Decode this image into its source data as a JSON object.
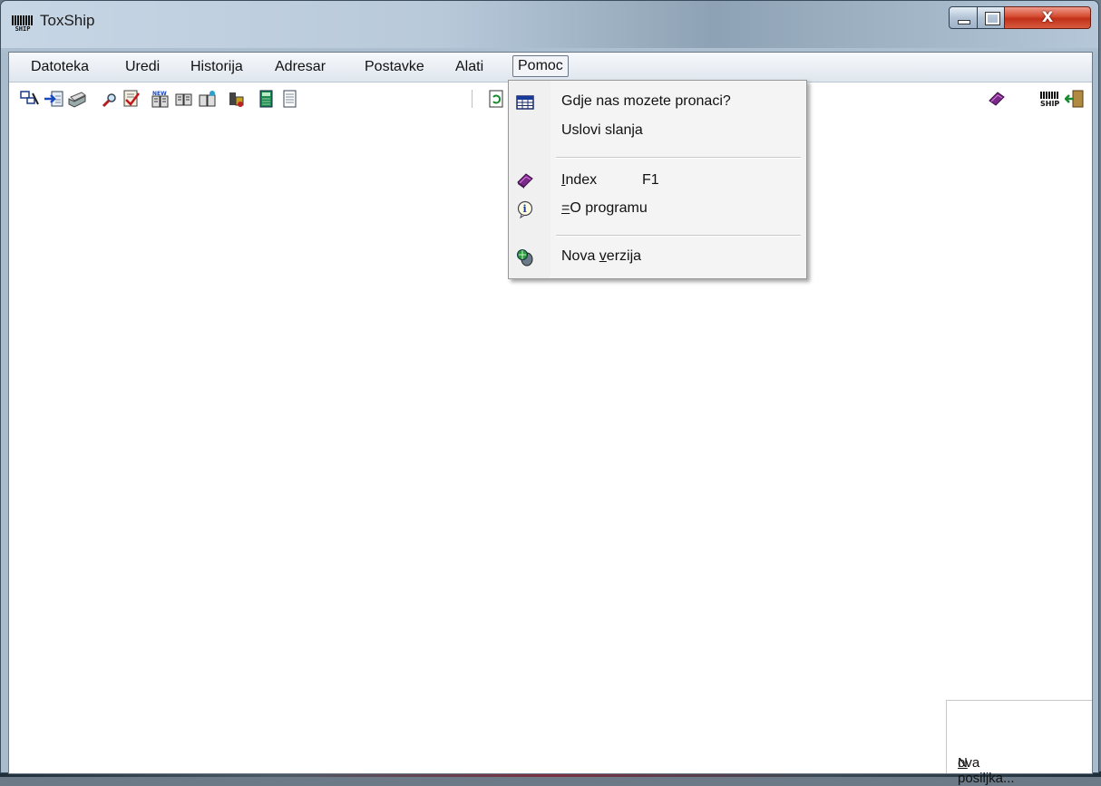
{
  "window": {
    "title": "ToxShip",
    "close_label": "X"
  },
  "menubar": {
    "items": [
      {
        "label": "Datoteka"
      },
      {
        "label": "Uredi"
      },
      {
        "label": "Historija"
      },
      {
        "label": "Adresar"
      },
      {
        "label": "Postavke"
      },
      {
        "label": "Alati"
      },
      {
        "label": "Pomoc",
        "open": true
      }
    ]
  },
  "toolbar": {
    "left_icons": [
      "window-link-icon",
      "import-icon",
      "printer-icon",
      "search-icon",
      "document-check-icon",
      "new-book-icon",
      "open-book-icon",
      "book-export-icon",
      "tools-icon",
      "calculator-icon",
      "notepad-icon",
      "refresh-icon"
    ],
    "right_icons": [
      "help-book-icon",
      "ship-barcode-icon",
      "exit-door-icon"
    ]
  },
  "help_menu": {
    "items": [
      {
        "label": "Gdje nas mozete pronaci?",
        "icon": "table-grid-icon"
      },
      {
        "label": "Uslovi slanja",
        "icon": ""
      },
      {
        "label_mnemonic": "I",
        "label_rest": "ndex",
        "shortcut": "F1",
        "icon": "help-book-icon"
      },
      {
        "label_mnemonic": "=",
        "label_rest": "O programu",
        "icon": "info-icon"
      },
      {
        "label_prefix": "Nova ",
        "label_mnemonic": "v",
        "label_rest": "erzija",
        "icon": "update-globe-icon"
      }
    ]
  },
  "new_package": {
    "mnemonic": "N",
    "rest": "ova posiljka..."
  },
  "icon_glyph": {
    "ship_icon_text": "SHIP"
  }
}
